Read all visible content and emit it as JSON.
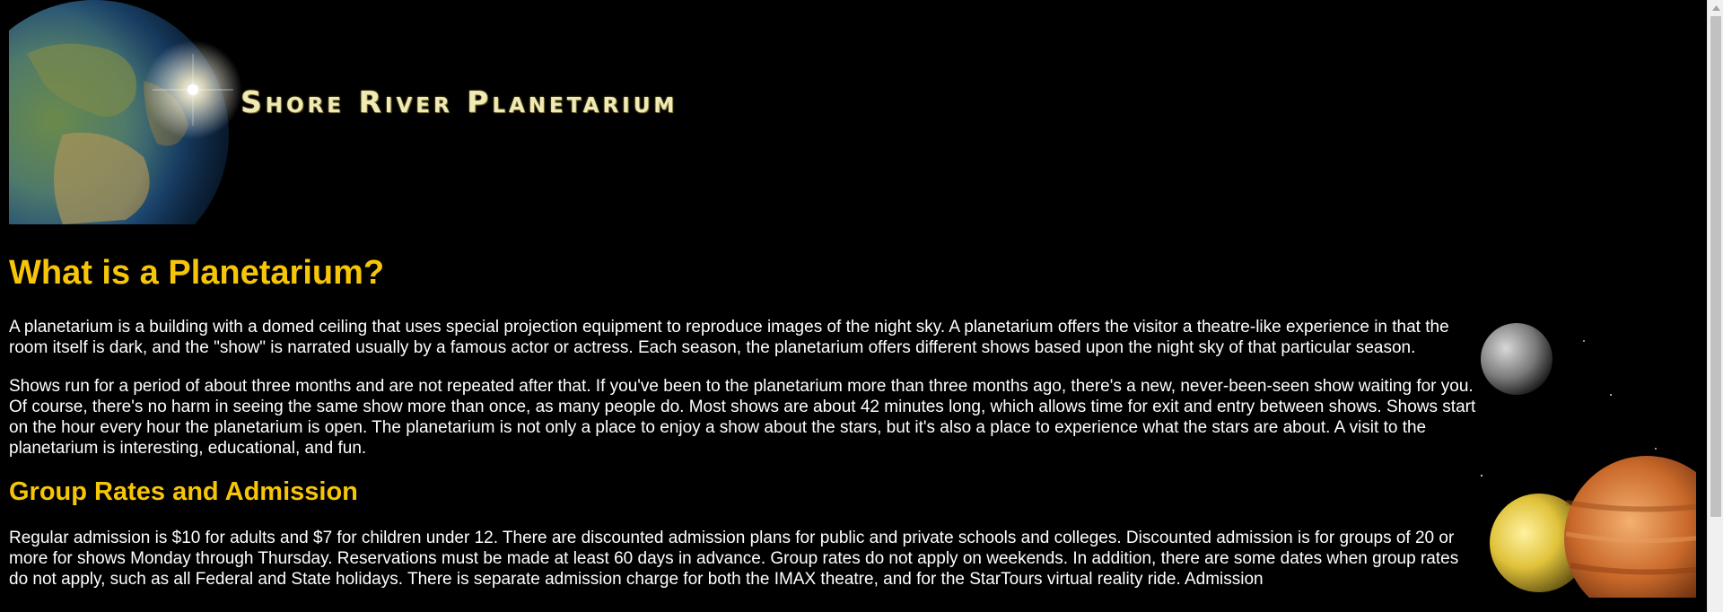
{
  "banner": {
    "title": "Shore River Planetarium"
  },
  "main": {
    "heading1": "What is a Planetarium?",
    "para1": "A planetarium is a building with a domed ceiling that uses special projection equipment to reproduce images of the night sky. A planetarium offers the visitor a theatre-like experience in that the room itself is dark, and the \"show\" is narrated usually by a famous actor or actress. Each season, the planetarium offers different shows based upon the night sky of that particular season.",
    "para2": "Shows run for a period of about three months and are not repeated after that. If you've been to the planetarium more than three months ago, there's a new, never-been-seen show waiting for you. Of course, there's no harm in seeing the same show more than once, as many people do. Most shows are about 42 minutes long, which allows time for exit and entry between shows. Shows start on the hour every hour the planetarium is open. The planetarium is not only a place to enjoy a show about the stars, but it's also a place to experience what the stars are about. A visit to the planetarium is interesting, educational, and fun.",
    "heading2": "Group Rates and Admission",
    "para3": "Regular admission is $10 for adults and $7 for children under 12. There are discounted admission plans for public and private schools and colleges. Discounted admission is for groups of 20 or more for shows Monday through Thursday. Reservations must be made at least 60 days in advance. Group rates do not apply on weekends. In addition, there are some dates when group rates do not apply, such as all Federal and State holidays. There is separate admission charge for both the IMAX theatre, and for the StarTours virtual reality ride. Admission"
  },
  "colors": {
    "background": "#000000",
    "heading": "#f7c507",
    "text": "#ffffff",
    "banner_title": "#f0eab4"
  },
  "icons": {
    "scroll_up": "triangle-up-icon"
  }
}
